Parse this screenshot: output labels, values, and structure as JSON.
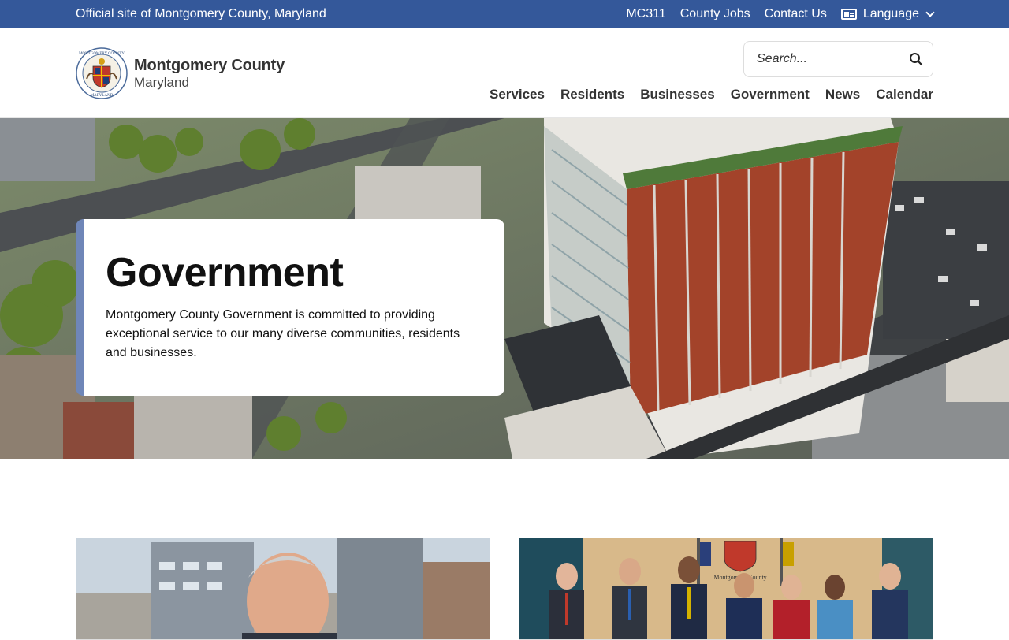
{
  "utility_bar": {
    "official_text": "Official site of Montgomery County, Maryland",
    "links": [
      "MC311",
      "County Jobs",
      "Contact Us"
    ],
    "language_label": "Language",
    "language_icon": "language-icon",
    "bg_color": "#34589a"
  },
  "header": {
    "logo_title": "Montgomery County",
    "logo_subtitle": "Maryland",
    "seal_icon": "county-seal-icon",
    "seal_text_top": "MONTGOMERY COUNTY",
    "seal_text_bottom": "MARYLAND",
    "search_placeholder": "Search...",
    "search_icon": "search-icon",
    "nav": [
      "Services",
      "Residents",
      "Businesses",
      "Government",
      "News",
      "Calendar"
    ]
  },
  "hero": {
    "title": "Government",
    "description": "Montgomery County Government is committed to providing exceptional service to our many diverse communities, residents and businesses.",
    "accent_color": "#6f86b8"
  },
  "cards": [
    {
      "image": "county-executive-photo"
    },
    {
      "image": "county-council-photo",
      "seal_caption": "Montgomery County"
    }
  ]
}
